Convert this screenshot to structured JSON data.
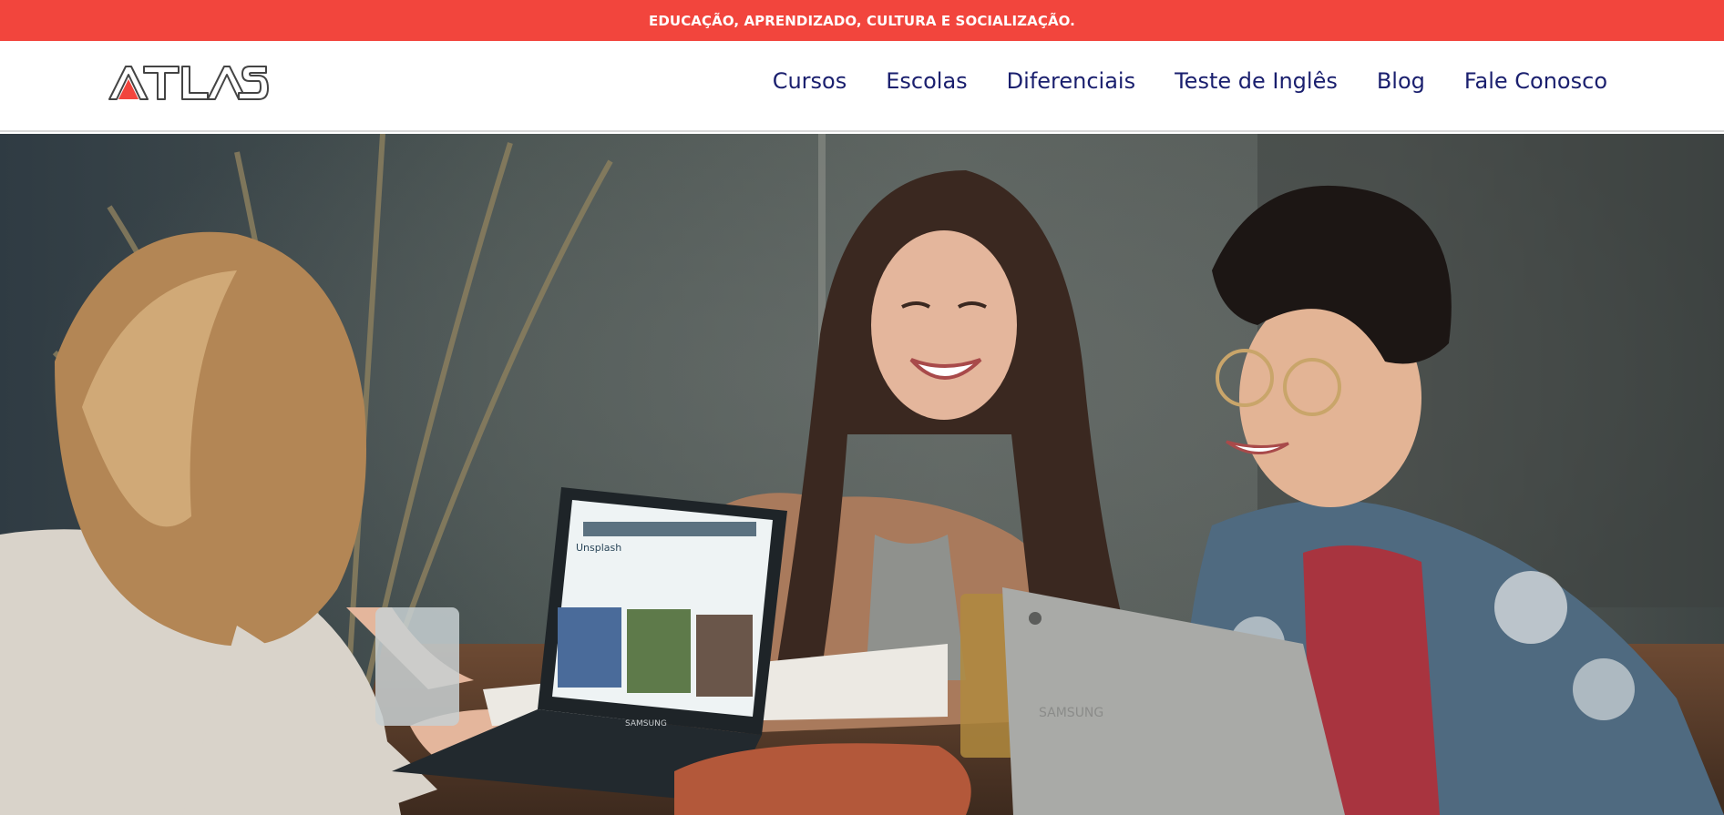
{
  "announcement": {
    "text": "EDUCAÇÃO, APRENDIZADO, CULTURA E SOCIALIZAÇÃO."
  },
  "brand": {
    "logo_text": "ATLAS",
    "accent": "#f2453d",
    "primary_text": "#1a1f6e"
  },
  "nav": {
    "items": [
      {
        "label": "Cursos"
      },
      {
        "label": "Escolas"
      },
      {
        "label": "Diferenciais"
      },
      {
        "label": "Teste de Inglês"
      },
      {
        "label": "Blog"
      },
      {
        "label": "Fale Conosco"
      }
    ]
  },
  "hero": {
    "laptop_brand_left": "SAMSUNG",
    "laptop_brand_right": "SAMSUNG",
    "screen_site_title": "Unsplash"
  }
}
